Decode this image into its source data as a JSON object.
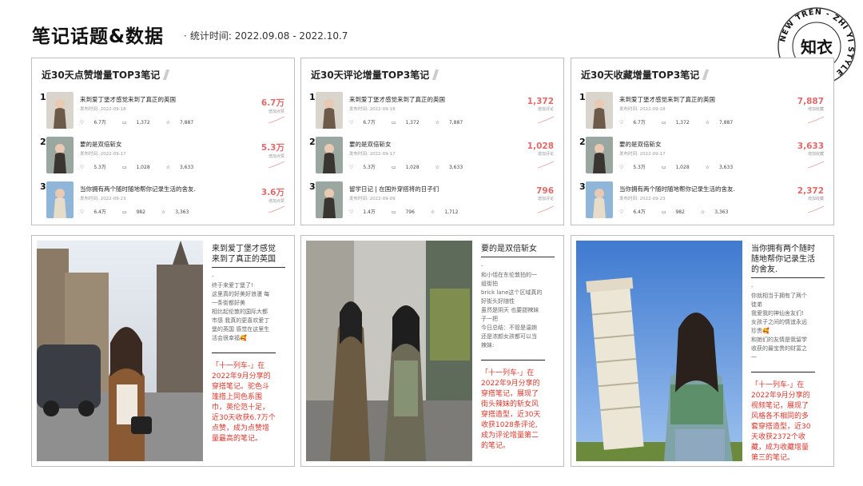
{
  "header": {
    "title": "笔记话题&数据",
    "stat_prefix": "·",
    "stat_label": "统计时间:",
    "stat_range": "2022.09.08 - 2022.10.7"
  },
  "logo": {
    "brand_cn": "知衣",
    "ring_text": "NEW TREN - ZHI YI STYLE GUIDE",
    "icon": "zhiyi-seal-logo"
  },
  "colors": {
    "accent_red": "#e06a6a",
    "highlight_red": "#d9362b",
    "rank_yellow": "#f3d64e"
  },
  "panels": [
    {
      "title": "近30天点赞增量TOP3笔记",
      "rows": [
        {
          "rank": "1",
          "title": "来到爱丁堡才感觉来到了真正的英国",
          "date": "发布时间: 2022-09-18",
          "likes": "6.7万",
          "comments": "1,372",
          "favs": "7,887",
          "metric": "6.7万",
          "metric_label": "增加点赞"
        },
        {
          "rank": "2",
          "title": "要的是双倍斩女",
          "date": "发布时间: 2022-09-17",
          "likes": "5.3万",
          "comments": "1,028",
          "favs": "3,633",
          "metric": "5.3万",
          "metric_label": "增加点赞"
        },
        {
          "rank": "3",
          "title": "当你拥有两个随时随地帮你记录生活的舍友.",
          "date": "发布时间: 2022-09-23",
          "likes": "6.4万",
          "comments": "982",
          "favs": "3,363",
          "metric": "3.6万",
          "metric_label": "增加点赞"
        }
      ]
    },
    {
      "title": "近30天评论增量TOP3笔记",
      "rows": [
        {
          "rank": "1",
          "title": "来到爱丁堡才感觉来到了真正的英国",
          "date": "发布时间: 2022-09-18",
          "likes": "6.7万",
          "comments": "1,372",
          "favs": "7,887",
          "metric": "1,372",
          "metric_label": "增加评论"
        },
        {
          "rank": "2",
          "title": "要的是双倍斩女",
          "date": "发布时间: 2022-09-17",
          "likes": "5.3万",
          "comments": "1,028",
          "favs": "3,633",
          "metric": "1,028",
          "metric_label": "增加评论"
        },
        {
          "rank": "3",
          "title": "留学日记 | 在国外穿搭将的日子们",
          "date": "发布时间: 2022-09-09",
          "likes": "1.4万",
          "comments": "796",
          "favs": "1,712",
          "metric": "796",
          "metric_label": "增加评论"
        }
      ]
    },
    {
      "title": "近30天收藏增量TOP3笔记",
      "rows": [
        {
          "rank": "1",
          "title": "来到爱丁堡才感觉来到了真正的英国",
          "date": "发布时间: 2022-09-18",
          "likes": "6.7万",
          "comments": "1,372",
          "favs": "7,887",
          "metric": "7,887",
          "metric_label": "增加收藏"
        },
        {
          "rank": "2",
          "title": "要的是双倍斩女",
          "date": "发布时间: 2022-09-17",
          "likes": "5.3万",
          "comments": "1,028",
          "favs": "3,633",
          "metric": "3,633",
          "metric_label": "增加收藏"
        },
        {
          "rank": "3",
          "title": "当你拥有两个随时随地帮你记录生活的舍友.",
          "date": "发布时间: 2022-09-23",
          "likes": "6.4万",
          "comments": "982",
          "favs": "3,363",
          "metric": "2,372",
          "metric_label": "增加收藏"
        }
      ]
    }
  ],
  "cards": [
    {
      "title_lines": [
        "来到爱丁堡才感觉",
        "来到了真正的英国"
      ],
      "desc_lines": [
        "-",
        "终于来爱丁堡了!",
        "这里真的好美好浪漫 每",
        "一条街都好美",
        "相比起伦敦的国际大都",
        "市感 我真的更喜欢爱丁",
        "堡的英国 感觉在这里生",
        "活会很幸福🥰"
      ],
      "highlight_lines": [
        "「十一列车-」在",
        "2022年9月分享的",
        "穿搭笔记。驼色斗",
        "篷搭上同色系围",
        "巾，英伦范十足，",
        "近30天收获6.7万个",
        "点赞，成为点赞增",
        "量最高的笔记。"
      ]
    },
    {
      "title_lines": [
        "要的是双倍斩女"
      ],
      "desc_lines": [
        "-",
        "和小恬在东伦敦拍的一",
        "组街拍",
        "brick lane这个区域真的",
        "好街头好随性",
        "虽然是阴天 也要甜辣妹",
        "子一把",
        "今日总结：不管是温婉",
        "还是浓颜女孩都可以当",
        "辣妹:"
      ],
      "highlight_lines": [
        "「十一列车-」在",
        "2022年9月分享的",
        "穿搭笔记，展现了",
        "街头辣妹的斩女风",
        "穿搭造型，近30天",
        "收获1028条评论,",
        "成为评论增量第二",
        "的笔记。"
      ]
    },
    {
      "title_lines": [
        "当你拥有两个随时",
        "随地帮你记录生活",
        "的舍友."
      ],
      "desc_lines": [
        "-",
        "你就相当于拥有了两个",
        "徒弟",
        "我爱我的神仙舍友们!",
        "女孩子之间的情谊永远",
        "珍贵🥰",
        "和她们的友情是我留学",
        "收获的最宝贵的财富之",
        "一"
      ],
      "highlight_lines": [
        "「十一列车-」在",
        "2022年9月分享的",
        "视频笔记，展现了",
        "风格各不相同的多",
        "套穿搭造型，近30",
        "天收获2372个收",
        "藏，成为收藏增量",
        "第三的笔记。"
      ]
    }
  ]
}
